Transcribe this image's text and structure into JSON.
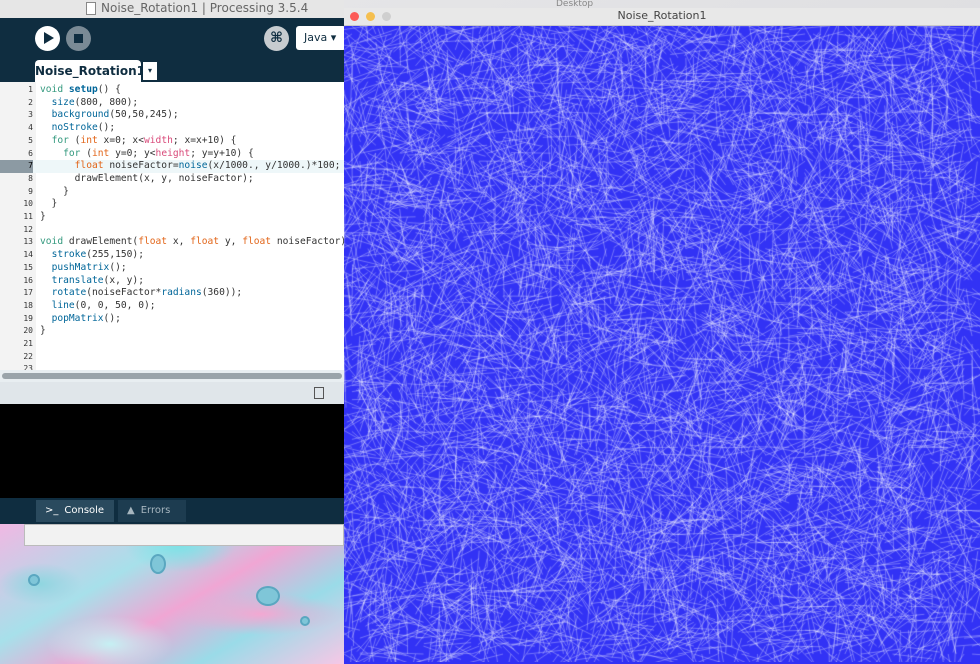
{
  "ide": {
    "window_title": "Noise_Rotation1 | Processing 3.5.4",
    "mode": "Java ▾",
    "tab_label": "Noise_Rotation1",
    "tab_menu": "▾",
    "debug_glyph": "⌘",
    "current_line": 7,
    "code_lines": [
      [
        {
          "t": "void ",
          "c": "kw"
        },
        {
          "t": "setup",
          "c": "fn"
        },
        {
          "t": "() {"
        }
      ],
      [
        {
          "t": "  "
        },
        {
          "t": "size",
          "c": "call"
        },
        {
          "t": "(800, 800);"
        }
      ],
      [
        {
          "t": "  "
        },
        {
          "t": "background",
          "c": "call"
        },
        {
          "t": "(50,50,245);"
        }
      ],
      [
        {
          "t": "  "
        },
        {
          "t": "noStroke",
          "c": "call"
        },
        {
          "t": "();"
        }
      ],
      [
        {
          "t": "  "
        },
        {
          "t": "for",
          "c": "kw"
        },
        {
          "t": " ("
        },
        {
          "t": "int",
          "c": "type"
        },
        {
          "t": " x=0; x<"
        },
        {
          "t": "width",
          "c": "const"
        },
        {
          "t": "; x=x+10) {"
        }
      ],
      [
        {
          "t": "    "
        },
        {
          "t": "for",
          "c": "kw"
        },
        {
          "t": " ("
        },
        {
          "t": "int",
          "c": "type"
        },
        {
          "t": " y=0; y<"
        },
        {
          "t": "height",
          "c": "const"
        },
        {
          "t": "; y=y+10) {"
        }
      ],
      [
        {
          "t": "      "
        },
        {
          "t": "float",
          "c": "type"
        },
        {
          "t": " noiseFactor="
        },
        {
          "t": "noise",
          "c": "call"
        },
        {
          "t": "(x/1000., y/1000.)*100;"
        }
      ],
      [
        {
          "t": "      drawElement(x, y, noiseFactor);"
        }
      ],
      [
        {
          "t": "    }"
        }
      ],
      [
        {
          "t": "  }"
        }
      ],
      [
        {
          "t": "}"
        }
      ],
      [
        {
          "t": ""
        }
      ],
      [
        {
          "t": "void ",
          "c": "kw"
        },
        {
          "t": "drawElement("
        },
        {
          "t": "float",
          "c": "type"
        },
        {
          "t": " x, "
        },
        {
          "t": "float",
          "c": "type"
        },
        {
          "t": " y, "
        },
        {
          "t": "float",
          "c": "type"
        },
        {
          "t": " noiseFactor)"
        }
      ],
      [
        {
          "t": "  "
        },
        {
          "t": "stroke",
          "c": "call"
        },
        {
          "t": "(255,150);"
        }
      ],
      [
        {
          "t": "  "
        },
        {
          "t": "pushMatrix",
          "c": "call"
        },
        {
          "t": "();"
        }
      ],
      [
        {
          "t": "  "
        },
        {
          "t": "translate",
          "c": "call"
        },
        {
          "t": "(x, y);"
        }
      ],
      [
        {
          "t": "  "
        },
        {
          "t": "rotate",
          "c": "call"
        },
        {
          "t": "(noiseFactor*"
        },
        {
          "t": "radians",
          "c": "call"
        },
        {
          "t": "(360));"
        }
      ],
      [
        {
          "t": "  "
        },
        {
          "t": "line",
          "c": "call"
        },
        {
          "t": "(0, 0, 50, 0);"
        }
      ],
      [
        {
          "t": "  "
        },
        {
          "t": "popMatrix",
          "c": "call"
        },
        {
          "t": "();"
        }
      ],
      [
        {
          "t": "}"
        }
      ],
      [
        {
          "t": ""
        }
      ],
      [
        {
          "t": ""
        }
      ],
      [
        {
          "t": ""
        }
      ]
    ],
    "bottom_tabs": {
      "console_label": "Console",
      "console_icon": ">_",
      "errors_label": "Errors",
      "errors_icon": "▲"
    }
  },
  "sketch": {
    "window_title": "Noise_Rotation1",
    "background_color": "#3232f5",
    "stroke_color": "#ffffff"
  },
  "desktop": {
    "label": "Desktop"
  }
}
